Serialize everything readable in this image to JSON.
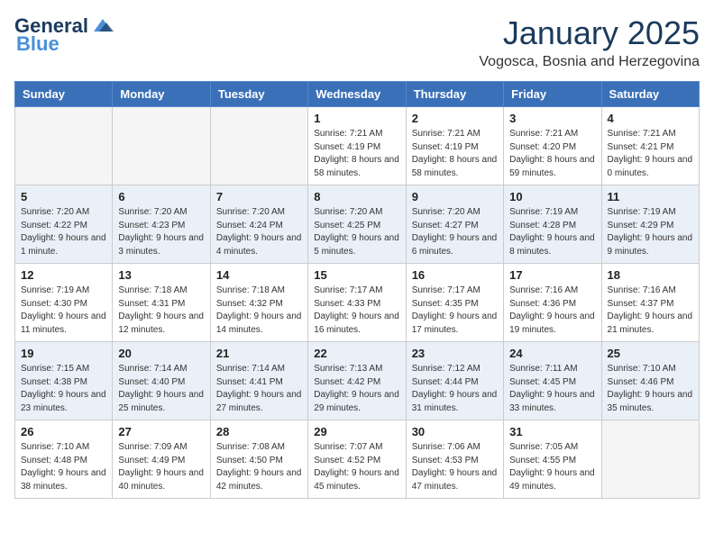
{
  "header": {
    "logo_general": "General",
    "logo_blue": "Blue",
    "month": "January 2025",
    "location": "Vogosca, Bosnia and Herzegovina"
  },
  "weekdays": [
    "Sunday",
    "Monday",
    "Tuesday",
    "Wednesday",
    "Thursday",
    "Friday",
    "Saturday"
  ],
  "weeks": [
    [
      {
        "date": "",
        "info": ""
      },
      {
        "date": "",
        "info": ""
      },
      {
        "date": "",
        "info": ""
      },
      {
        "date": "1",
        "info": "Sunrise: 7:21 AM\nSunset: 4:19 PM\nDaylight: 8 hours and 58 minutes."
      },
      {
        "date": "2",
        "info": "Sunrise: 7:21 AM\nSunset: 4:19 PM\nDaylight: 8 hours and 58 minutes."
      },
      {
        "date": "3",
        "info": "Sunrise: 7:21 AM\nSunset: 4:20 PM\nDaylight: 8 hours and 59 minutes."
      },
      {
        "date": "4",
        "info": "Sunrise: 7:21 AM\nSunset: 4:21 PM\nDaylight: 9 hours and 0 minutes."
      }
    ],
    [
      {
        "date": "5",
        "info": "Sunrise: 7:20 AM\nSunset: 4:22 PM\nDaylight: 9 hours and 1 minute."
      },
      {
        "date": "6",
        "info": "Sunrise: 7:20 AM\nSunset: 4:23 PM\nDaylight: 9 hours and 3 minutes."
      },
      {
        "date": "7",
        "info": "Sunrise: 7:20 AM\nSunset: 4:24 PM\nDaylight: 9 hours and 4 minutes."
      },
      {
        "date": "8",
        "info": "Sunrise: 7:20 AM\nSunset: 4:25 PM\nDaylight: 9 hours and 5 minutes."
      },
      {
        "date": "9",
        "info": "Sunrise: 7:20 AM\nSunset: 4:27 PM\nDaylight: 9 hours and 6 minutes."
      },
      {
        "date": "10",
        "info": "Sunrise: 7:19 AM\nSunset: 4:28 PM\nDaylight: 9 hours and 8 minutes."
      },
      {
        "date": "11",
        "info": "Sunrise: 7:19 AM\nSunset: 4:29 PM\nDaylight: 9 hours and 9 minutes."
      }
    ],
    [
      {
        "date": "12",
        "info": "Sunrise: 7:19 AM\nSunset: 4:30 PM\nDaylight: 9 hours and 11 minutes."
      },
      {
        "date": "13",
        "info": "Sunrise: 7:18 AM\nSunset: 4:31 PM\nDaylight: 9 hours and 12 minutes."
      },
      {
        "date": "14",
        "info": "Sunrise: 7:18 AM\nSunset: 4:32 PM\nDaylight: 9 hours and 14 minutes."
      },
      {
        "date": "15",
        "info": "Sunrise: 7:17 AM\nSunset: 4:33 PM\nDaylight: 9 hours and 16 minutes."
      },
      {
        "date": "16",
        "info": "Sunrise: 7:17 AM\nSunset: 4:35 PM\nDaylight: 9 hours and 17 minutes."
      },
      {
        "date": "17",
        "info": "Sunrise: 7:16 AM\nSunset: 4:36 PM\nDaylight: 9 hours and 19 minutes."
      },
      {
        "date": "18",
        "info": "Sunrise: 7:16 AM\nSunset: 4:37 PM\nDaylight: 9 hours and 21 minutes."
      }
    ],
    [
      {
        "date": "19",
        "info": "Sunrise: 7:15 AM\nSunset: 4:38 PM\nDaylight: 9 hours and 23 minutes."
      },
      {
        "date": "20",
        "info": "Sunrise: 7:14 AM\nSunset: 4:40 PM\nDaylight: 9 hours and 25 minutes."
      },
      {
        "date": "21",
        "info": "Sunrise: 7:14 AM\nSunset: 4:41 PM\nDaylight: 9 hours and 27 minutes."
      },
      {
        "date": "22",
        "info": "Sunrise: 7:13 AM\nSunset: 4:42 PM\nDaylight: 9 hours and 29 minutes."
      },
      {
        "date": "23",
        "info": "Sunrise: 7:12 AM\nSunset: 4:44 PM\nDaylight: 9 hours and 31 minutes."
      },
      {
        "date": "24",
        "info": "Sunrise: 7:11 AM\nSunset: 4:45 PM\nDaylight: 9 hours and 33 minutes."
      },
      {
        "date": "25",
        "info": "Sunrise: 7:10 AM\nSunset: 4:46 PM\nDaylight: 9 hours and 35 minutes."
      }
    ],
    [
      {
        "date": "26",
        "info": "Sunrise: 7:10 AM\nSunset: 4:48 PM\nDaylight: 9 hours and 38 minutes."
      },
      {
        "date": "27",
        "info": "Sunrise: 7:09 AM\nSunset: 4:49 PM\nDaylight: 9 hours and 40 minutes."
      },
      {
        "date": "28",
        "info": "Sunrise: 7:08 AM\nSunset: 4:50 PM\nDaylight: 9 hours and 42 minutes."
      },
      {
        "date": "29",
        "info": "Sunrise: 7:07 AM\nSunset: 4:52 PM\nDaylight: 9 hours and 45 minutes."
      },
      {
        "date": "30",
        "info": "Sunrise: 7:06 AM\nSunset: 4:53 PM\nDaylight: 9 hours and 47 minutes."
      },
      {
        "date": "31",
        "info": "Sunrise: 7:05 AM\nSunset: 4:55 PM\nDaylight: 9 hours and 49 minutes."
      },
      {
        "date": "",
        "info": ""
      }
    ]
  ]
}
